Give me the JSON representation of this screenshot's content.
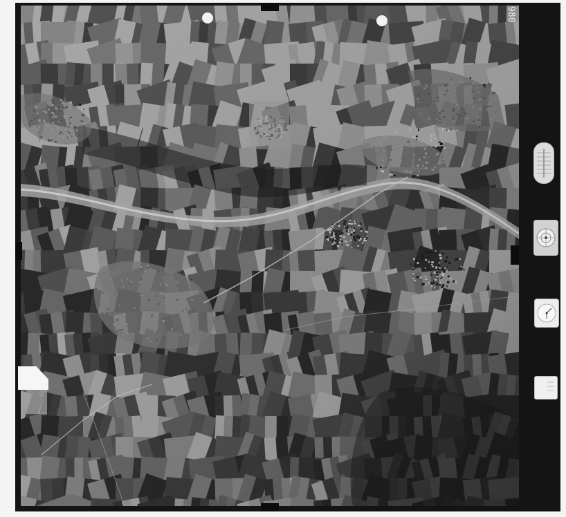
{
  "image": {
    "kind": "aerial-survey-photograph",
    "palette": {
      "film_border": "#141414",
      "paper": "#f4f4f4",
      "field_dark": "#2b2b2b",
      "field_mid": "#5a5a5a",
      "field_light": "#9a9a9a",
      "river": "#bdbdbd"
    }
  },
  "frame_number": "980",
  "instruments": {
    "altimeter_icon": "altimeter-dial-icon",
    "clock_icon": "clock-dial-icon",
    "compass_icon": "level-bubble-icon",
    "data_tag_icon": "data-card-icon"
  }
}
